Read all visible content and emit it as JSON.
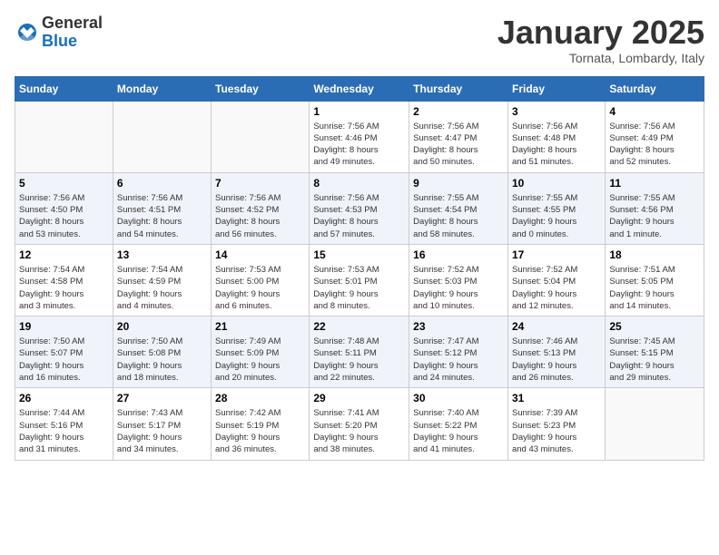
{
  "header": {
    "logo_line1": "General",
    "logo_line2": "Blue",
    "month": "January 2025",
    "location": "Tornata, Lombardy, Italy"
  },
  "columns": [
    "Sunday",
    "Monday",
    "Tuesday",
    "Wednesday",
    "Thursday",
    "Friday",
    "Saturday"
  ],
  "weeks": [
    [
      {
        "day": "",
        "info": ""
      },
      {
        "day": "",
        "info": ""
      },
      {
        "day": "",
        "info": ""
      },
      {
        "day": "1",
        "info": "Sunrise: 7:56 AM\nSunset: 4:46 PM\nDaylight: 8 hours\nand 49 minutes."
      },
      {
        "day": "2",
        "info": "Sunrise: 7:56 AM\nSunset: 4:47 PM\nDaylight: 8 hours\nand 50 minutes."
      },
      {
        "day": "3",
        "info": "Sunrise: 7:56 AM\nSunset: 4:48 PM\nDaylight: 8 hours\nand 51 minutes."
      },
      {
        "day": "4",
        "info": "Sunrise: 7:56 AM\nSunset: 4:49 PM\nDaylight: 8 hours\nand 52 minutes."
      }
    ],
    [
      {
        "day": "5",
        "info": "Sunrise: 7:56 AM\nSunset: 4:50 PM\nDaylight: 8 hours\nand 53 minutes."
      },
      {
        "day": "6",
        "info": "Sunrise: 7:56 AM\nSunset: 4:51 PM\nDaylight: 8 hours\nand 54 minutes."
      },
      {
        "day": "7",
        "info": "Sunrise: 7:56 AM\nSunset: 4:52 PM\nDaylight: 8 hours\nand 56 minutes."
      },
      {
        "day": "8",
        "info": "Sunrise: 7:56 AM\nSunset: 4:53 PM\nDaylight: 8 hours\nand 57 minutes."
      },
      {
        "day": "9",
        "info": "Sunrise: 7:55 AM\nSunset: 4:54 PM\nDaylight: 8 hours\nand 58 minutes."
      },
      {
        "day": "10",
        "info": "Sunrise: 7:55 AM\nSunset: 4:55 PM\nDaylight: 9 hours\nand 0 minutes."
      },
      {
        "day": "11",
        "info": "Sunrise: 7:55 AM\nSunset: 4:56 PM\nDaylight: 9 hours\nand 1 minute."
      }
    ],
    [
      {
        "day": "12",
        "info": "Sunrise: 7:54 AM\nSunset: 4:58 PM\nDaylight: 9 hours\nand 3 minutes."
      },
      {
        "day": "13",
        "info": "Sunrise: 7:54 AM\nSunset: 4:59 PM\nDaylight: 9 hours\nand 4 minutes."
      },
      {
        "day": "14",
        "info": "Sunrise: 7:53 AM\nSunset: 5:00 PM\nDaylight: 9 hours\nand 6 minutes."
      },
      {
        "day": "15",
        "info": "Sunrise: 7:53 AM\nSunset: 5:01 PM\nDaylight: 9 hours\nand 8 minutes."
      },
      {
        "day": "16",
        "info": "Sunrise: 7:52 AM\nSunset: 5:03 PM\nDaylight: 9 hours\nand 10 minutes."
      },
      {
        "day": "17",
        "info": "Sunrise: 7:52 AM\nSunset: 5:04 PM\nDaylight: 9 hours\nand 12 minutes."
      },
      {
        "day": "18",
        "info": "Sunrise: 7:51 AM\nSunset: 5:05 PM\nDaylight: 9 hours\nand 14 minutes."
      }
    ],
    [
      {
        "day": "19",
        "info": "Sunrise: 7:50 AM\nSunset: 5:07 PM\nDaylight: 9 hours\nand 16 minutes."
      },
      {
        "day": "20",
        "info": "Sunrise: 7:50 AM\nSunset: 5:08 PM\nDaylight: 9 hours\nand 18 minutes."
      },
      {
        "day": "21",
        "info": "Sunrise: 7:49 AM\nSunset: 5:09 PM\nDaylight: 9 hours\nand 20 minutes."
      },
      {
        "day": "22",
        "info": "Sunrise: 7:48 AM\nSunset: 5:11 PM\nDaylight: 9 hours\nand 22 minutes."
      },
      {
        "day": "23",
        "info": "Sunrise: 7:47 AM\nSunset: 5:12 PM\nDaylight: 9 hours\nand 24 minutes."
      },
      {
        "day": "24",
        "info": "Sunrise: 7:46 AM\nSunset: 5:13 PM\nDaylight: 9 hours\nand 26 minutes."
      },
      {
        "day": "25",
        "info": "Sunrise: 7:45 AM\nSunset: 5:15 PM\nDaylight: 9 hours\nand 29 minutes."
      }
    ],
    [
      {
        "day": "26",
        "info": "Sunrise: 7:44 AM\nSunset: 5:16 PM\nDaylight: 9 hours\nand 31 minutes."
      },
      {
        "day": "27",
        "info": "Sunrise: 7:43 AM\nSunset: 5:17 PM\nDaylight: 9 hours\nand 34 minutes."
      },
      {
        "day": "28",
        "info": "Sunrise: 7:42 AM\nSunset: 5:19 PM\nDaylight: 9 hours\nand 36 minutes."
      },
      {
        "day": "29",
        "info": "Sunrise: 7:41 AM\nSunset: 5:20 PM\nDaylight: 9 hours\nand 38 minutes."
      },
      {
        "day": "30",
        "info": "Sunrise: 7:40 AM\nSunset: 5:22 PM\nDaylight: 9 hours\nand 41 minutes."
      },
      {
        "day": "31",
        "info": "Sunrise: 7:39 AM\nSunset: 5:23 PM\nDaylight: 9 hours\nand 43 minutes."
      },
      {
        "day": "",
        "info": ""
      }
    ]
  ]
}
